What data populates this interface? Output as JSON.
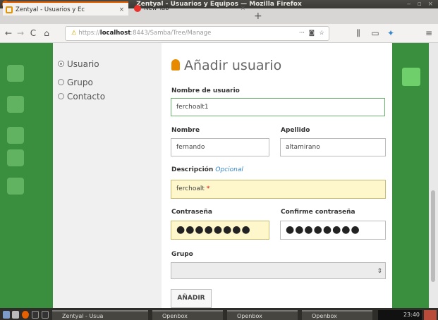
{
  "window": {
    "title": "Zentyal - Usuarios y Equipos — Mozilla Firefox"
  },
  "tabs": [
    {
      "label": "Zentyal - Usuarios y Ec",
      "close": "×"
    },
    {
      "label": "New Tab",
      "close": "×"
    }
  ],
  "newtab": "+",
  "nav": {
    "url_prefix": "https://",
    "url_host": "localhost",
    "url_path": ":8443/Samba/Tree/Manage",
    "more": "···",
    "back": "←",
    "forward": "→",
    "reload": "C",
    "home": "⌂"
  },
  "sidebar_options": [
    {
      "label": "Usuario",
      "selected": true
    },
    {
      "label": "Grupo",
      "selected": false
    },
    {
      "label": "Contacto",
      "selected": false
    }
  ],
  "form": {
    "title": "Añadir usuario",
    "username_label": "Nombre de usuario",
    "username_value": "ferchoalt1",
    "name_label": "Nombre",
    "name_value": "fernando",
    "surname_label": "Apellido",
    "surname_value": "altamirano",
    "desc_label": "Descripción",
    "desc_optional": "Opcional",
    "desc_value": "ferchoalt",
    "desc_required": "*",
    "password_label": "Contraseña",
    "password_value": "●●●●●●●●",
    "confirm_label": "Confirme contraseña",
    "confirm_value": "●●●●●●●●",
    "group_label": "Grupo",
    "group_value": "",
    "submit": "AÑADIR"
  },
  "taskbar": {
    "items": [
      "Zentyal - Usua",
      "Openbox",
      "Openbox",
      "Openbox"
    ],
    "clock": "23:40"
  },
  "colors": {
    "brand_green": "#3a8f3f",
    "accent_orange": "#e88a00",
    "required_bg": "#fff7cc"
  }
}
